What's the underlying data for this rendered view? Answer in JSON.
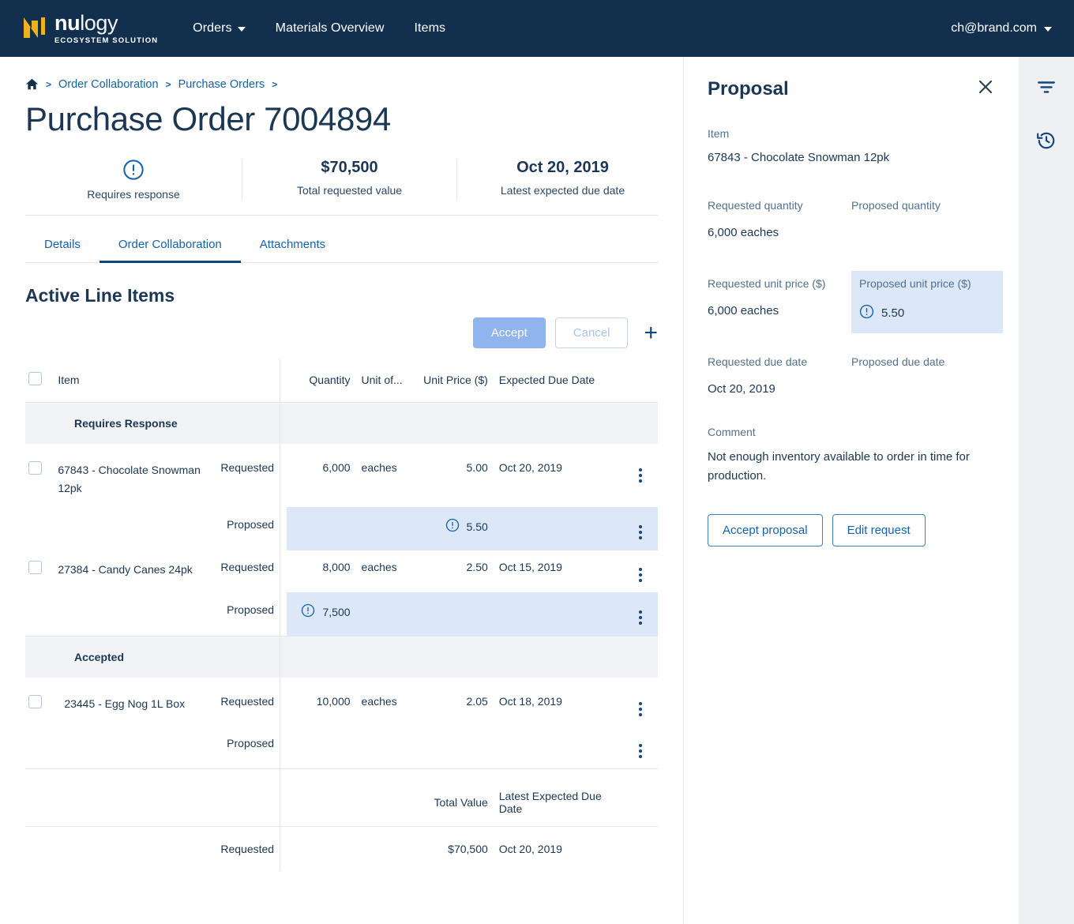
{
  "brand": {
    "name_bold": "nu",
    "name_light": "logy",
    "tagline": "ECOSYSTEM SOLUTION",
    "logo_color": "#efb21f"
  },
  "topnav": {
    "links": [
      {
        "label": "Orders",
        "has_caret": true
      },
      {
        "label": "Materials Overview",
        "has_caret": false
      },
      {
        "label": "Items",
        "has_caret": false
      }
    ],
    "user": "ch@brand.com",
    "bg_color": "#12304e"
  },
  "breadcrumb": {
    "home_icon": "home-icon",
    "items": [
      "Order Collaboration",
      "Purchase Orders"
    ],
    "separator": ">"
  },
  "page": {
    "title": "Purchase Order 7004894"
  },
  "stats": [
    {
      "icon": "alert-circle-icon",
      "value": "",
      "label": "Requires response"
    },
    {
      "icon": "",
      "value": "$70,500",
      "label": "Total requested value"
    },
    {
      "icon": "",
      "value": "Oct 20, 2019",
      "label": "Latest expected due date"
    }
  ],
  "tabs": [
    {
      "label": "Details",
      "active": false
    },
    {
      "label": "Order Collaboration",
      "active": true
    },
    {
      "label": "Attachments",
      "active": false
    }
  ],
  "section": {
    "title": "Active Line Items",
    "accept_label": "Accept",
    "cancel_label": "Cancel",
    "add_label": "+"
  },
  "table": {
    "headers": {
      "item": "Item",
      "quantity": "Quantity",
      "uom": "Unit of...",
      "unit_price": "Unit Price ($)",
      "due_date": "Expected Due Date"
    },
    "groups": [
      {
        "name": "Requires Response",
        "rows": [
          {
            "item": "67843 - Chocolate Snowman 12pk",
            "requested": {
              "type": "Requested",
              "quantity": "6,000",
              "uom": "eaches",
              "unit_price": "5.00",
              "due_date": "Oct 20, 2019",
              "warn_on": ""
            },
            "proposed": {
              "type": "Proposed",
              "quantity": "",
              "uom": "",
              "unit_price": "5.50",
              "due_date": "",
              "warn_on": "unit_price",
              "highlight": true
            }
          },
          {
            "item": "27384 - Candy Canes 24pk",
            "requested": {
              "type": "Requested",
              "quantity": "8,000",
              "uom": "eaches",
              "unit_price": "2.50",
              "due_date": "Oct 15, 2019",
              "warn_on": ""
            },
            "proposed": {
              "type": "Proposed",
              "quantity": "7,500",
              "uom": "",
              "unit_price": "",
              "due_date": "",
              "warn_on": "quantity",
              "highlight": true
            }
          }
        ]
      },
      {
        "name": "Accepted",
        "rows": [
          {
            "item": "23445 - Egg Nog 1L Box",
            "requested": {
              "type": "Requested",
              "quantity": "10,000",
              "uom": "eaches",
              "unit_price": "2.05",
              "due_date": "Oct 18, 2019",
              "warn_on": ""
            },
            "proposed": {
              "type": "Proposed",
              "quantity": "",
              "uom": "",
              "unit_price": "",
              "due_date": "",
              "warn_on": "",
              "highlight": false
            }
          }
        ]
      }
    ],
    "footer": {
      "total_value_header": "Total Value",
      "latest_due_header": "Latest Expected Due Date",
      "requested_label": "Requested",
      "total_value": "$70,500",
      "latest_due": "Oct 20, 2019"
    }
  },
  "proposal": {
    "title": "Proposal",
    "close_icon": "close-icon",
    "item_label": "Item",
    "item_value": "67843 - Chocolate Snowman 12pk",
    "requested_quantity_label": "Requested quantity",
    "proposed_quantity_label": "Proposed quantity",
    "requested_quantity_value": "6,000 eaches",
    "proposed_quantity_value": "",
    "requested_unit_price_label": "Requested unit price ($)",
    "proposed_unit_price_label": "Proposed unit price ($)",
    "requested_unit_price_value": "6,000 eaches",
    "proposed_unit_price_value": "5.50",
    "requested_due_date_label": "Requested due date",
    "proposed_due_date_label": "Proposed due date",
    "requested_due_date_value": "Oct 20, 2019",
    "proposed_due_date_value": "",
    "comment_label": "Comment",
    "comment_value": "Not enough inventory available to order in time for production.",
    "accept_proposal_label": "Accept proposal",
    "edit_request_label": "Edit request",
    "highlight_color": "#dce7f7"
  },
  "rail": {
    "filter_icon": "filter-icon",
    "history_icon": "history-icon"
  },
  "colors": {
    "accent_blue": "#1462ad",
    "dark_navy": "#12304e",
    "highlight_row": "#dce7f7",
    "group_header": "#f1f3f7"
  }
}
